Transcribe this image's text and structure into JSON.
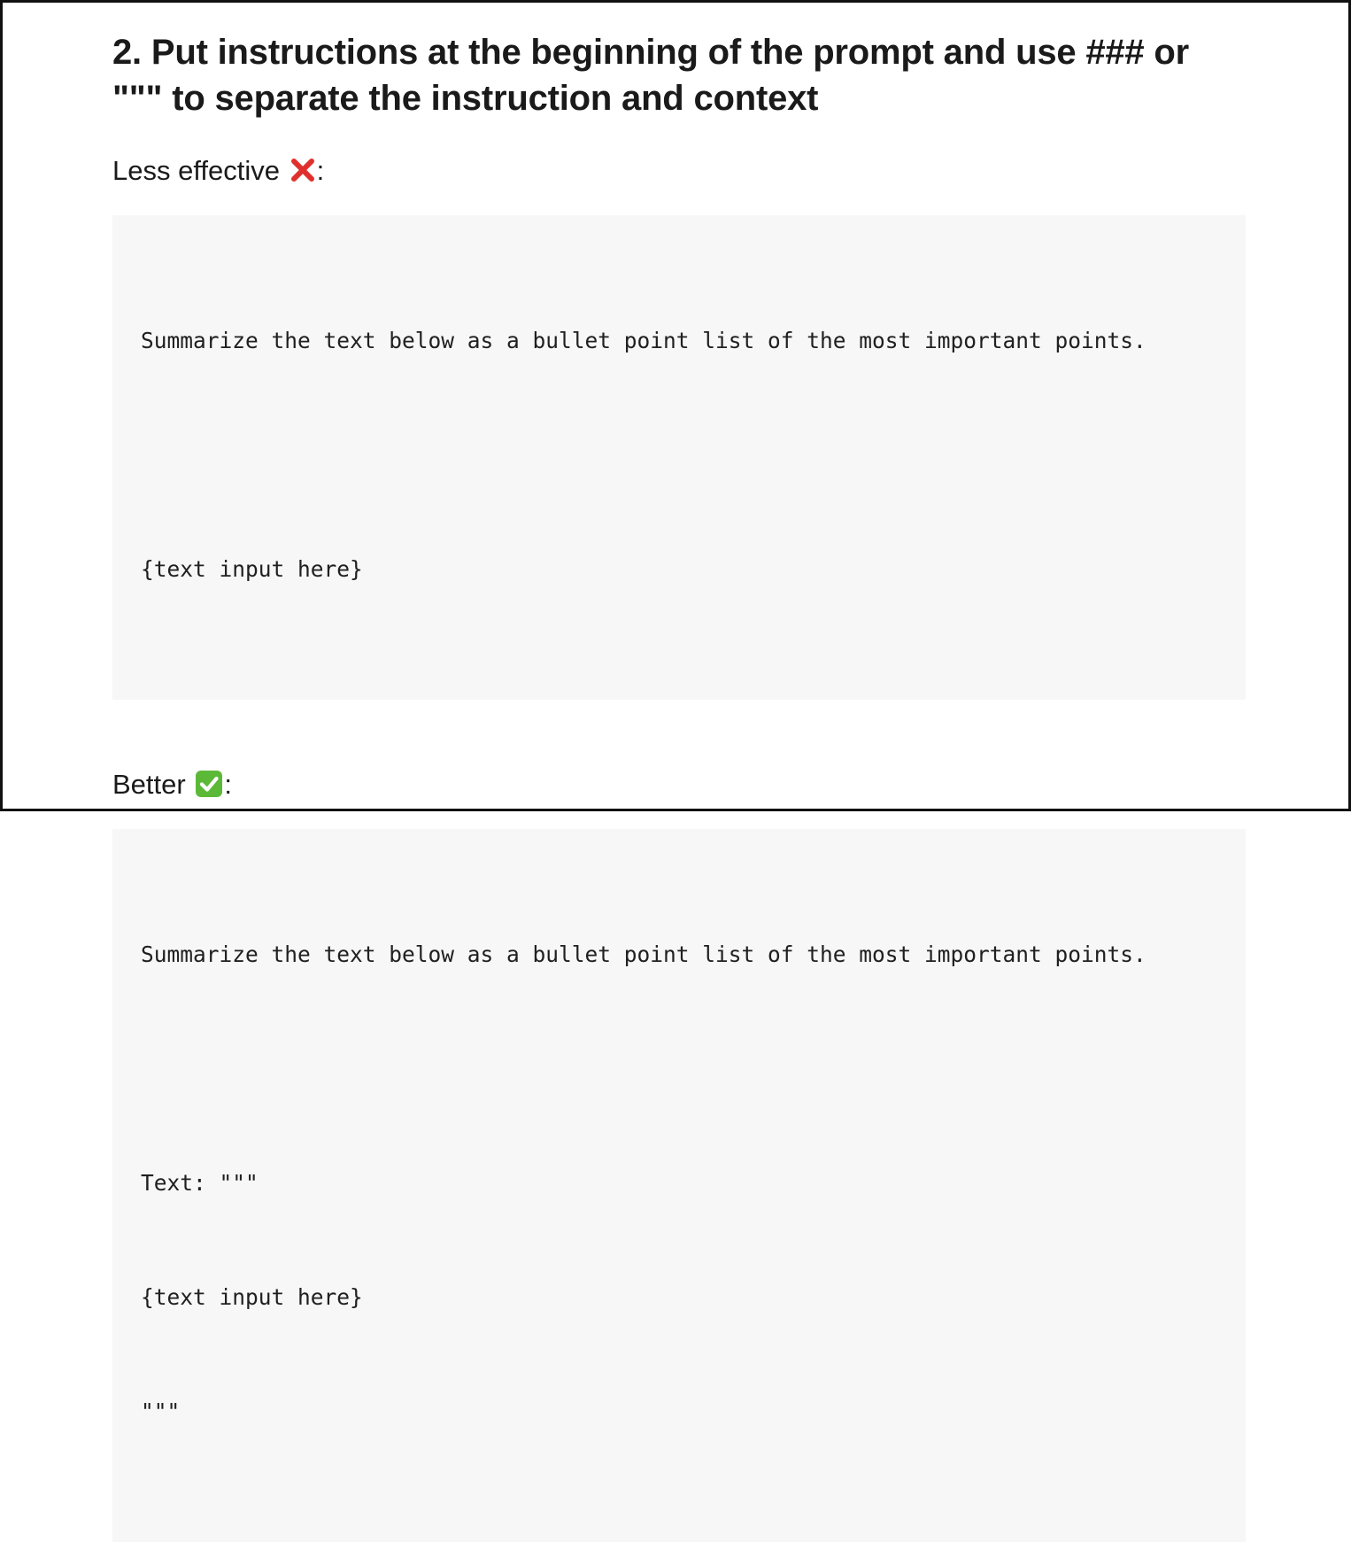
{
  "heading": "2. Put instructions at the beginning of the prompt and use ### or \"\"\" to separate the instruction and context",
  "less_effective": {
    "label": "Less effective",
    "icon": "cross-mark-icon",
    "suffix": ":",
    "code_lines": [
      "Summarize the text below as a bullet point list of the most important points.",
      "",
      "{text input here}"
    ]
  },
  "better": {
    "label": "Better",
    "icon": "check-mark-button-icon",
    "suffix": ":",
    "code_lines": [
      "Summarize the text below as a bullet point list of the most important points.",
      "",
      "Text: \"\"\"",
      "{text input here}",
      "\"\"\""
    ]
  },
  "colors": {
    "cross": "#e0302d",
    "check_bg": "#5cb938",
    "code_bg": "#f7f7f7",
    "border": "#111111"
  }
}
